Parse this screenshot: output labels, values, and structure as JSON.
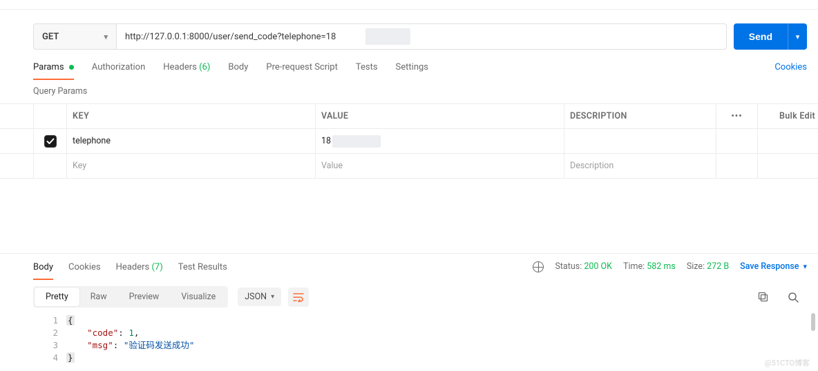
{
  "request": {
    "method": "GET",
    "url": "http://127.0.0.1:8000/user/send_code?telephone=18",
    "send_label": "Send"
  },
  "tabs": {
    "items": [
      {
        "label": "Params",
        "active": true,
        "badge": "dot"
      },
      {
        "label": "Authorization"
      },
      {
        "label": "Headers",
        "count": "(6)"
      },
      {
        "label": "Body"
      },
      {
        "label": "Pre-request Script"
      },
      {
        "label": "Tests"
      },
      {
        "label": "Settings"
      }
    ],
    "cookies_label": "Cookies"
  },
  "query_params": {
    "title": "Query Params",
    "columns": {
      "key": "KEY",
      "value": "VALUE",
      "description": "DESCRIPTION",
      "bulk": "Bulk Edit"
    },
    "rows": [
      {
        "checked": true,
        "key": "telephone",
        "value": "18"
      }
    ],
    "placeholder_row": {
      "key": "Key",
      "value": "Value",
      "description": "Description"
    }
  },
  "response": {
    "tabs": [
      {
        "label": "Body",
        "active": true
      },
      {
        "label": "Cookies"
      },
      {
        "label": "Headers",
        "count": "(7)"
      },
      {
        "label": "Test Results"
      }
    ],
    "status": {
      "label": "Status:",
      "value": "200 OK"
    },
    "time": {
      "label": "Time:",
      "value": "582 ms"
    },
    "size": {
      "label": "Size:",
      "value": "272 B"
    },
    "save_label": "Save Response",
    "views": [
      "Pretty",
      "Raw",
      "Preview",
      "Visualize"
    ],
    "active_view": "Pretty",
    "format": "JSON",
    "body": {
      "lines": [
        "1",
        "2",
        "3",
        "4"
      ],
      "key1": "\"code\"",
      "val1": "1",
      "key2": "\"msg\"",
      "val2": "\"验证码发送成功\""
    }
  },
  "watermark": "@51CTO博客"
}
